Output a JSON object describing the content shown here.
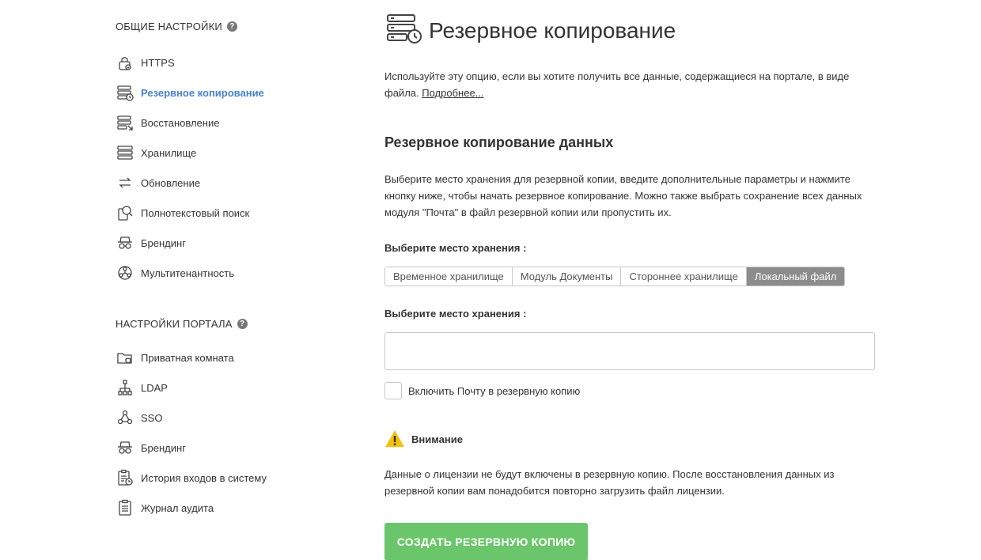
{
  "sidebar": {
    "general_heading": "ОБЩИЕ НАСТРОЙКИ",
    "general_items": [
      {
        "label": "HTTPS",
        "icon": "lock-icon"
      },
      {
        "label": "Резервное копирование",
        "icon": "backup-icon",
        "active": true
      },
      {
        "label": "Восстановление",
        "icon": "restore-icon"
      },
      {
        "label": "Хранилище",
        "icon": "storage-icon"
      },
      {
        "label": "Обновление",
        "icon": "update-icon"
      },
      {
        "label": "Полнотекстовый поиск",
        "icon": "fulltext-search-icon"
      },
      {
        "label": "Брендинг",
        "icon": "branding-icon"
      },
      {
        "label": "Мультитенантность",
        "icon": "multitenancy-icon"
      }
    ],
    "portal_heading": "НАСТРОЙКИ ПОРТАЛА",
    "portal_items": [
      {
        "label": "Приватная комната",
        "icon": "private-room-icon"
      },
      {
        "label": "LDAP",
        "icon": "ldap-icon"
      },
      {
        "label": "SSO",
        "icon": "sso-icon"
      },
      {
        "label": "Брендинг",
        "icon": "branding-icon"
      },
      {
        "label": "История входов в систему",
        "icon": "login-history-icon"
      },
      {
        "label": "Журнал аудита",
        "icon": "audit-log-icon"
      }
    ],
    "help_glyph": "?"
  },
  "main": {
    "title": "Резервное копирование",
    "intro": "Используйте эту опцию, если вы хотите получить все данные, содержащиеся на портале, в виде файла.",
    "intro_link": "Подробнее...",
    "section_title": "Резервное копирование данных",
    "section_text": "Выберите место хранения для резервной копии, введите дополнительные параметры и нажмите кнопку ниже, чтобы начать резервное копирование. Можно также выбрать сохранение всех данных модуля \"Почта\" в файл резервной копии или пропустить их.",
    "storage_label": "Выберите место хранения :",
    "storage_tabs": [
      {
        "label": "Временное хранилище"
      },
      {
        "label": "Модуль Документы"
      },
      {
        "label": "Стороннее хранилище"
      },
      {
        "label": "Локальный файл",
        "selected": true
      }
    ],
    "path_label": "Выберите место хранения :",
    "path_value": "",
    "include_mail_label": "Включить Почту в резервную копию",
    "warning_title": "Внимание",
    "warning_text": "Данные о лицензии не будут включены в резервную копию. После восстановления данных из резервной копии вам понадобится повторно загрузить файл лицензии.",
    "create_button": "СОЗДАТЬ РЕЗЕРВНУЮ КОПИЮ"
  },
  "colors": {
    "accent": "#4781d1",
    "button": "#6bc56b",
    "selected_tab": "#8c8c8c",
    "warning": "#f4c20d"
  }
}
